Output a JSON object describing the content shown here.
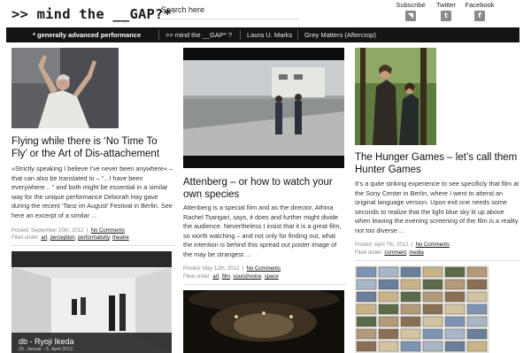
{
  "site": {
    "title": ">> mind the __GAP?*"
  },
  "search": {
    "placeholder": "Search here"
  },
  "social": [
    {
      "label": "Subscribe",
      "icon": "rss-icon",
      "glyph": "◥"
    },
    {
      "label": "Twitter",
      "icon": "twitter-icon",
      "glyph": "t"
    },
    {
      "label": "Facebook",
      "icon": "facebook-icon",
      "glyph": "f"
    }
  ],
  "nav": {
    "tagline": "* generally advanced performance",
    "items": [
      ">> mind the __GAP* ?",
      "Laura U. Marks",
      "Grey Matters (Aftercrop)"
    ]
  },
  "colors": {
    "navbar": "#141414",
    "meta_text": "#888888",
    "divider": "#e2e2e2"
  },
  "posts": [
    {
      "title": "Flying while there is ‘No Time To Fly’ or the Art of Dis-attachement",
      "excerpt": "»Strictly speaking I believe I’ve never been anywhere« – that can also be translated to – “.. I have been everywhere .. ” and both might be essential in a similar way for the unique performance Deborah Hay gave during the recent ‘Tanz im August’ Festival in Berlin. See here an excerpt of a similar ...",
      "posted": "Posted: September 20th, 2012",
      "comments": "No Comments",
      "filed_label": "Filed under:",
      "tags": [
        "art",
        "perception",
        "performativity",
        "theatre"
      ]
    },
    {
      "title": "Attenberg – or how to watch your own species",
      "excerpt": "Attenberg is a special film and as the director, Athina Rachel Tsangari, says, it does and further might divide the audience. Nevertheless I insist that it is a great film, so worth watching – and not only for finding out, what the intention is behind this spread out poster image of the may be strangest ...",
      "posted": "Posted: May 12th, 2012",
      "comments": "No Comments",
      "filed_label": "Filed under:",
      "tags": [
        "art",
        "film",
        "sound/voice",
        "space"
      ]
    },
    {
      "title": "The Hunger Games – let’s call them Hunter Games",
      "excerpt": "It’s a quite striking experience to see specificly that film at the Sony Center in Berlin, where I went to attend an original language version. Upon exit one needs some seconds to realize that the light blue sky lit up above when leaving the evening screening of the film is a reality not too diverse ...",
      "posted": "Posted: April 7th, 2012",
      "comments": "No Comments",
      "filed_label": "Filed under:",
      "tags": [
        "comment",
        "media"
      ]
    }
  ],
  "bottom_thumbs": [
    {
      "caption_title": "db - Ryoji Ikeda",
      "caption_sub": "25. Januar - 5. April 2012"
    }
  ]
}
